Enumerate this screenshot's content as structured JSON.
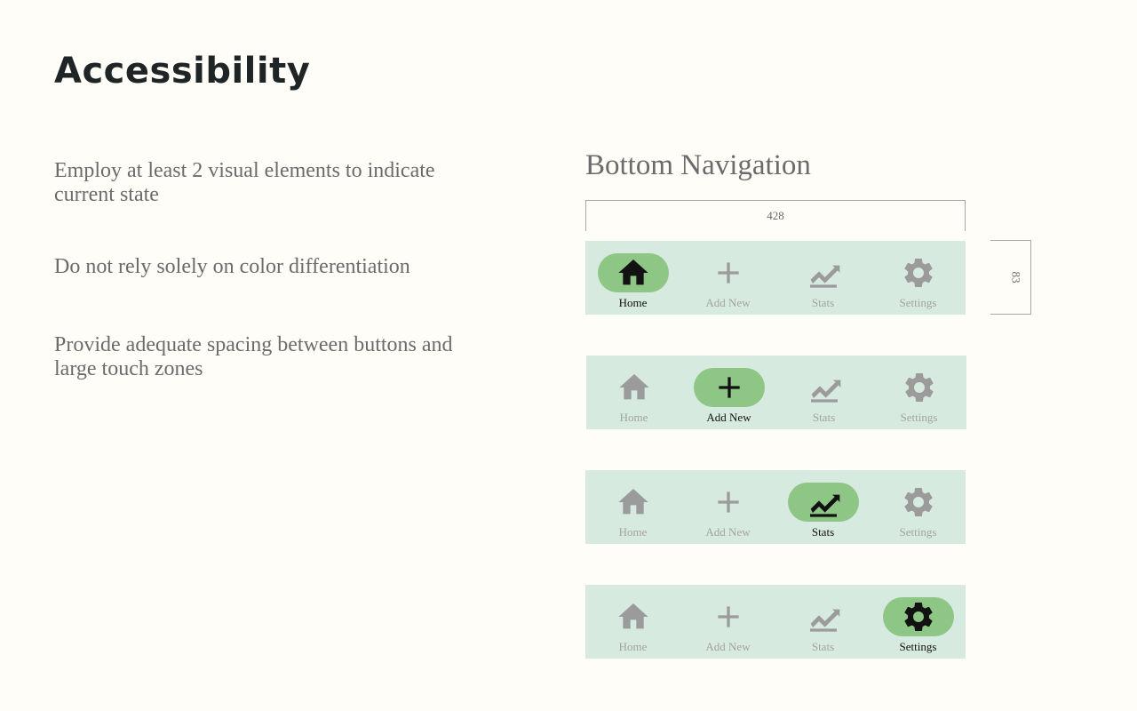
{
  "page": {
    "title": "Accessibility",
    "principles": [
      "Employ at least 2 visual elements to indicate current state",
      "Do not rely solely on color differentiation",
      "Provide adequate spacing between buttons and large touch zones"
    ]
  },
  "bottom_navigation": {
    "title": "Bottom Navigation",
    "width_annotation": "428",
    "height_annotation": "83",
    "items": [
      {
        "label": "Home",
        "icon": "home-icon"
      },
      {
        "label": "Add New",
        "icon": "add-icon"
      },
      {
        "label": "Stats",
        "icon": "stats-icon"
      },
      {
        "label": "Settings",
        "icon": "gear-icon"
      }
    ],
    "variants": [
      {
        "active_item": "Home"
      },
      {
        "active_item": "Add New"
      },
      {
        "active_item": "Stats"
      },
      {
        "active_item": "Settings"
      }
    ]
  },
  "colors": {
    "background": "#fefdf8",
    "nav_background": "#d7eae0",
    "active_pill": "#8ec785",
    "active_icon": "#121212",
    "inactive_icon": "#9b9b9b",
    "inactive_label": "#a3a3a3",
    "body_text": "#6b6b6b",
    "title_text": "#1f2527"
  }
}
